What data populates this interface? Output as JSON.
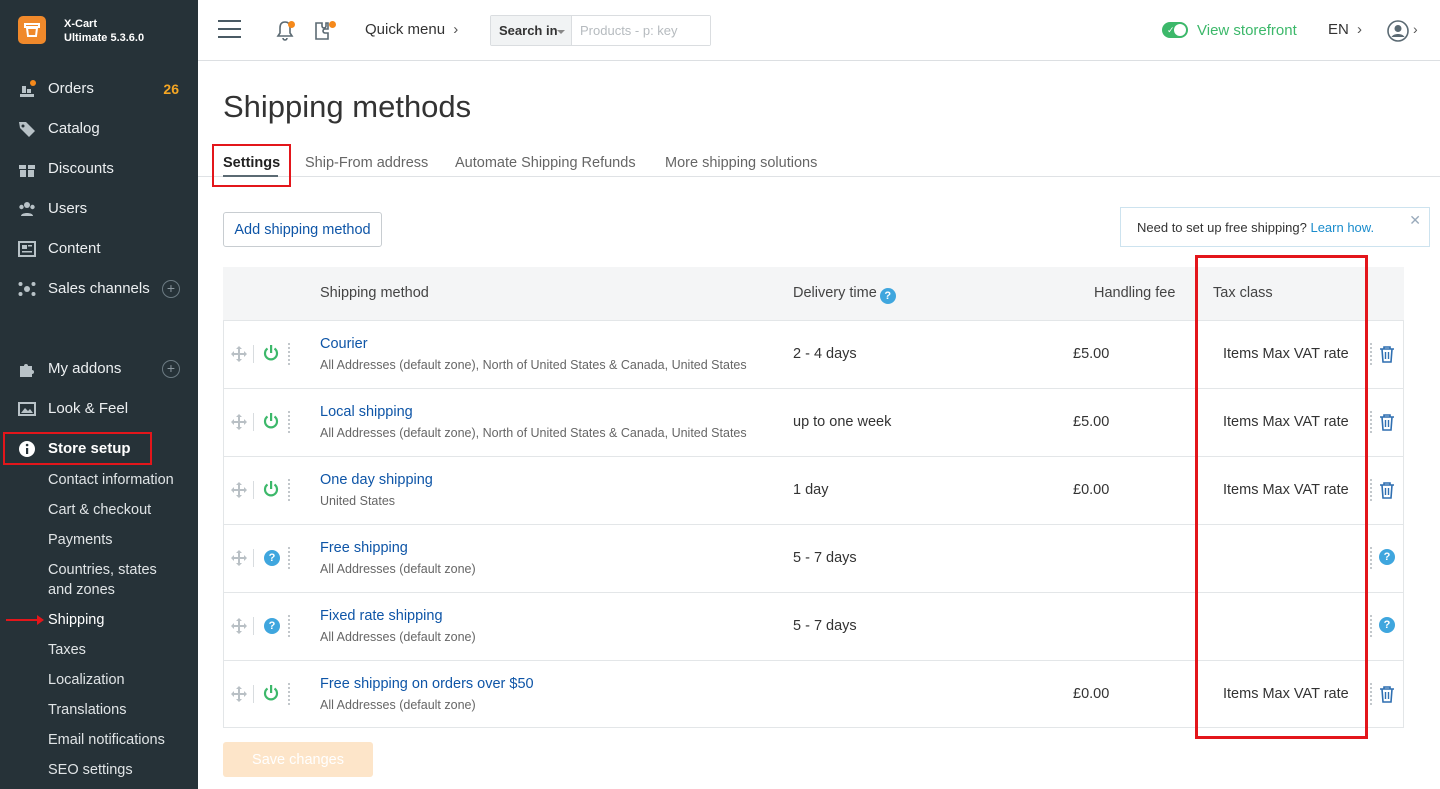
{
  "brand": {
    "name": "X-Cart",
    "version": "Ultimate 5.3.6.0"
  },
  "sidebar": {
    "items": [
      {
        "label": "Orders",
        "badge": "26",
        "icon": "orders-icon"
      },
      {
        "label": "Catalog",
        "icon": "tag-icon"
      },
      {
        "label": "Discounts",
        "icon": "gift-icon"
      },
      {
        "label": "Users",
        "icon": "users-icon"
      },
      {
        "label": "Content",
        "icon": "content-icon"
      },
      {
        "label": "Sales channels",
        "icon": "channels-icon"
      },
      {
        "label": "My addons",
        "icon": "puzzle-icon"
      },
      {
        "label": "Look & Feel",
        "icon": "image-icon"
      },
      {
        "label": "Store setup",
        "icon": "info-icon"
      }
    ],
    "store_setup_sub": [
      "Contact information",
      "Cart & checkout",
      "Payments",
      "Countries, states",
      "and zones",
      "Shipping",
      "Taxes",
      "Localization",
      "Translations",
      "Email notifications",
      "SEO settings"
    ]
  },
  "header": {
    "quick_menu": "Quick menu",
    "search_in": "Search in",
    "search_placeholder": "Products - p: key",
    "view_storefront": "View storefront",
    "lang": "EN"
  },
  "page": {
    "title": "Shipping methods",
    "tabs": [
      "Settings",
      "Ship-From address",
      "Automate Shipping Refunds",
      "More shipping solutions"
    ],
    "add_button": "Add shipping method",
    "promo_text": "Need to set up free shipping?",
    "promo_link": "Learn how.",
    "save_button": "Save changes"
  },
  "table": {
    "headers": {
      "method": "Shipping method",
      "delivery": "Delivery time",
      "fee": "Handling fee",
      "tax": "Tax class"
    },
    "rows": [
      {
        "name": "Courier",
        "zone": "All Addresses (default zone), North of United States & Canada, United States",
        "time": "2 - 4 days",
        "fee": "£5.00",
        "tax": "Items Max VAT rate",
        "enabled": true
      },
      {
        "name": "Local shipping",
        "zone": "All Addresses (default zone), North of United States & Canada, United States",
        "time": "up to one week",
        "fee": "£5.00",
        "tax": "Items Max VAT rate",
        "enabled": true
      },
      {
        "name": "One day shipping",
        "zone": "United States",
        "time": "1 day",
        "fee": "£0.00",
        "tax": "Items Max VAT rate",
        "enabled": true
      },
      {
        "name": "Free shipping",
        "zone": "All Addresses (default zone)",
        "time": "5 - 7 days",
        "fee": "",
        "tax": "",
        "enabled": false
      },
      {
        "name": "Fixed rate shipping",
        "zone": "All Addresses (default zone)",
        "time": "5 - 7 days",
        "fee": "",
        "tax": "",
        "enabled": false
      },
      {
        "name": "Free shipping on orders over $50",
        "zone": "All Addresses (default zone)",
        "time": "",
        "fee": "£0.00",
        "tax": "Items Max VAT rate",
        "enabled": true
      }
    ]
  },
  "colors": {
    "sidebar": "#263238",
    "accent": "#f0892b",
    "link": "#0e55a7",
    "green": "#3cb86a",
    "highlight": "#e3161b"
  }
}
